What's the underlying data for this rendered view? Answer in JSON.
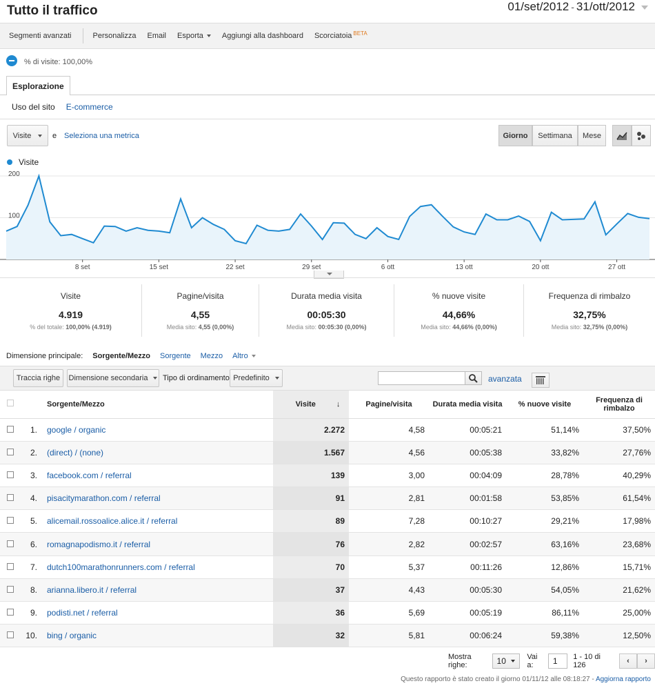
{
  "header": {
    "title": "Tutto il traffico",
    "date_start": "01/set/2012",
    "date_sep": "-",
    "date_end": "31/ott/2012"
  },
  "toolbar": {
    "segmenti": "Segmenti avanzati",
    "personalizza": "Personalizza",
    "email": "Email",
    "esporta": "Esporta",
    "dashboard": "Aggiungi alla dashboard",
    "scorciatoia": "Scorciatoia",
    "beta": "BETA"
  },
  "segment": {
    "text": "% di visite: 100,00%"
  },
  "tabs": {
    "main": "Esplorazione",
    "sub1": "Uso del sito",
    "sub2": "E-commerce"
  },
  "controls": {
    "metric": "Visite",
    "and": "e",
    "select_metric": "Seleziona una metrica",
    "day": "Giorno",
    "week": "Settimana",
    "month": "Mese"
  },
  "chart_data": {
    "type": "area",
    "series": [
      {
        "name": "Visite",
        "values": [
          68,
          79,
          130,
          200,
          90,
          57,
          60,
          50,
          40,
          80,
          79,
          68,
          76,
          70,
          68,
          64,
          145,
          76,
          100,
          84,
          72,
          45,
          38,
          82,
          70,
          68,
          72,
          109,
          80,
          48,
          88,
          87,
          60,
          50,
          76,
          55,
          48,
          103,
          127,
          131,
          104,
          78,
          66,
          60,
          109,
          95,
          95,
          104,
          91,
          45,
          113,
          95,
          96,
          97,
          138,
          59,
          85,
          110,
          101,
          98
        ]
      }
    ],
    "x_tick_labels": [
      "8 set",
      "15 set",
      "22 set",
      "29 set",
      "6 ott",
      "13 ott",
      "20 ott",
      "27 ott"
    ],
    "y_tick_labels": [
      "200",
      "100"
    ],
    "ylim": [
      0,
      200
    ],
    "grid": true,
    "color": "#1f8ad1"
  },
  "summary": [
    {
      "label": "Visite",
      "value": "4.919",
      "sub_prefix": "% del totale: ",
      "sub_value": "100,00% (4.919)"
    },
    {
      "label": "Pagine/visita",
      "value": "4,55",
      "sub_prefix": "Media sito: ",
      "sub_value": "4,55 (0,00%)"
    },
    {
      "label": "Durata media visita",
      "value": "00:05:30",
      "sub_prefix": "Media sito: ",
      "sub_value": "00:05:30 (0,00%)"
    },
    {
      "label": "% nuove visite",
      "value": "44,66%",
      "sub_prefix": "Media sito: ",
      "sub_value": "44,66% (0,00%)"
    },
    {
      "label": "Frequenza di rimbalzo",
      "value": "32,75%",
      "sub_prefix": "Media sito: ",
      "sub_value": "32,75% (0,00%)"
    }
  ],
  "dimension": {
    "label": "Dimensione principale:",
    "active": "Sorgente/Mezzo",
    "opt1": "Sorgente",
    "opt2": "Mezzo",
    "more": "Altro"
  },
  "tablebar": {
    "track": "Traccia righe",
    "secondary": "Dimensione secondaria",
    "sort_label": "Tipo di ordinamento:",
    "sort_value": "Predefinito",
    "advanced": "avanzata"
  },
  "table": {
    "headers": [
      "Sorgente/Mezzo",
      "Visite",
      "Pagine/visita",
      "Durata media visita",
      "% nuove visite",
      "Frequenza di rimbalzo"
    ],
    "rows": [
      [
        "1.",
        "google / organic",
        "2.272",
        "4,58",
        "00:05:21",
        "51,14%",
        "37,50%"
      ],
      [
        "2.",
        "(direct) / (none)",
        "1.567",
        "4,56",
        "00:05:38",
        "33,82%",
        "27,76%"
      ],
      [
        "3.",
        "facebook.com / referral",
        "139",
        "3,00",
        "00:04:09",
        "28,78%",
        "40,29%"
      ],
      [
        "4.",
        "pisacitymarathon.com / referral",
        "91",
        "2,81",
        "00:01:58",
        "53,85%",
        "61,54%"
      ],
      [
        "5.",
        "alicemail.rossoalice.alice.it / referral",
        "89",
        "7,28",
        "00:10:27",
        "29,21%",
        "17,98%"
      ],
      [
        "6.",
        "romagnapodismo.it / referral",
        "76",
        "2,82",
        "00:02:57",
        "63,16%",
        "23,68%"
      ],
      [
        "7.",
        "dutch100marathonrunners.com / referral",
        "70",
        "5,37",
        "00:11:26",
        "12,86%",
        "15,71%"
      ],
      [
        "8.",
        "arianna.libero.it / referral",
        "37",
        "4,43",
        "00:05:30",
        "54,05%",
        "21,62%"
      ],
      [
        "9.",
        "podisti.net / referral",
        "36",
        "5,69",
        "00:05:19",
        "86,11%",
        "25,00%"
      ],
      [
        "10.",
        "bing / organic",
        "32",
        "5,81",
        "00:06:24",
        "59,38%",
        "12,50%"
      ]
    ]
  },
  "pager": {
    "show_rows": "Mostra righe:",
    "rows_value": "10",
    "goto": "Vai a:",
    "goto_value": "1",
    "range": "1 - 10 di 126"
  },
  "footer": {
    "text": "Questo rapporto è stato creato il giorno 01/11/12 alle 08:18:27 - ",
    "link": "Aggiorna rapporto"
  }
}
